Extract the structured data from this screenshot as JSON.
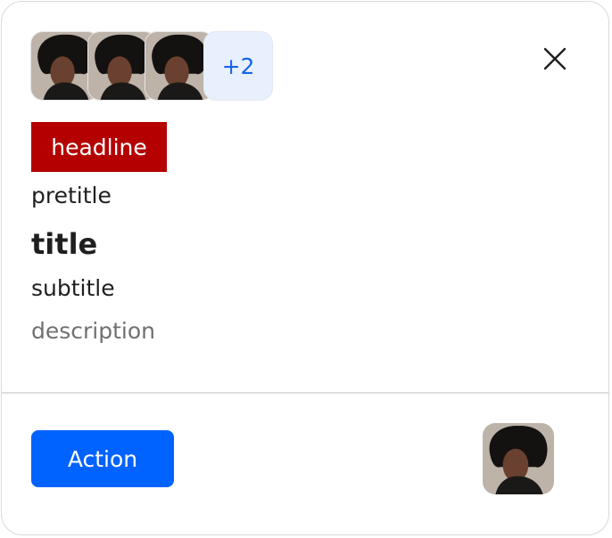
{
  "header": {
    "avatars": [
      {
        "icon": "person-photo-avatar"
      },
      {
        "icon": "person-photo-avatar"
      },
      {
        "icon": "person-photo-avatar"
      }
    ],
    "overflow_count_label": "+2",
    "close_icon": "close-icon"
  },
  "content": {
    "headline": "headline",
    "pretitle": "pretitle",
    "title": "title",
    "subtitle": "subtitle",
    "description": "description"
  },
  "footer": {
    "action_label": "Action",
    "avatar_icon": "person-photo-avatar"
  },
  "colors": {
    "headline_bg": "#b50000",
    "action_bg": "#0062ff",
    "overflow_bg": "#e8f0fd",
    "overflow_text": "#1565e6"
  }
}
